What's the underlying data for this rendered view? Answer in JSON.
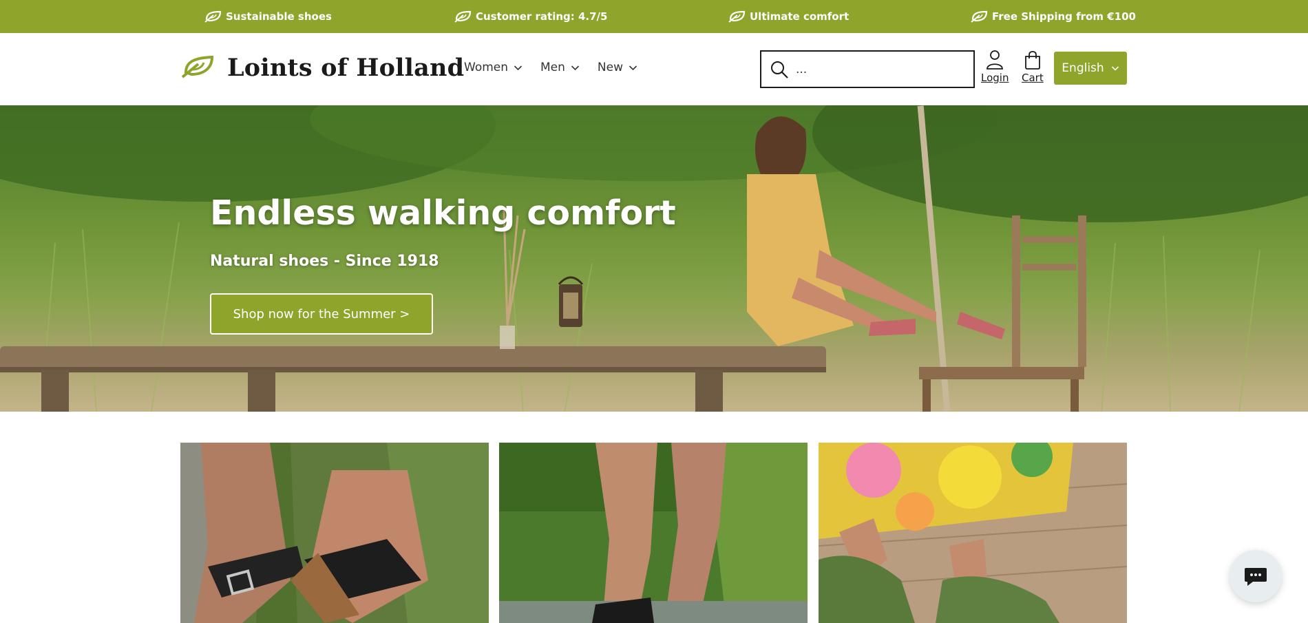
{
  "announcement_bar": {
    "items": [
      {
        "icon": "leaf-logo-icon",
        "text": "Sustainable shoes"
      },
      {
        "icon": "leaf-logo-icon",
        "text": "Customer rating: 4.7/5"
      },
      {
        "icon": "leaf-logo-icon",
        "text": "Ultimate comfort"
      },
      {
        "icon": "leaf-logo-icon",
        "text": "Free Shipping from €100"
      }
    ]
  },
  "header": {
    "brand": "Loints of Holland",
    "nav": [
      {
        "label": "Women"
      },
      {
        "label": "Men"
      },
      {
        "label": "New"
      }
    ],
    "search": {
      "placeholder": "..."
    },
    "login_label": "Login",
    "cart_label": "Cart",
    "language": "English"
  },
  "hero": {
    "title": "Endless walking comfort",
    "subtitle": "Natural shoes - Since 1918",
    "cta_label": "Shop now for the Summer >"
  },
  "tiles": [
    {
      "icon": "black-sandals-photo"
    },
    {
      "icon": "man-walking-photo"
    },
    {
      "icon": "green-mary-jane-shoes-photo"
    }
  ],
  "theme": {
    "brand_green": "#8ea42b",
    "text_dark": "#1a1a1a"
  },
  "chat": {
    "icon": "chat-bubble-icon"
  }
}
